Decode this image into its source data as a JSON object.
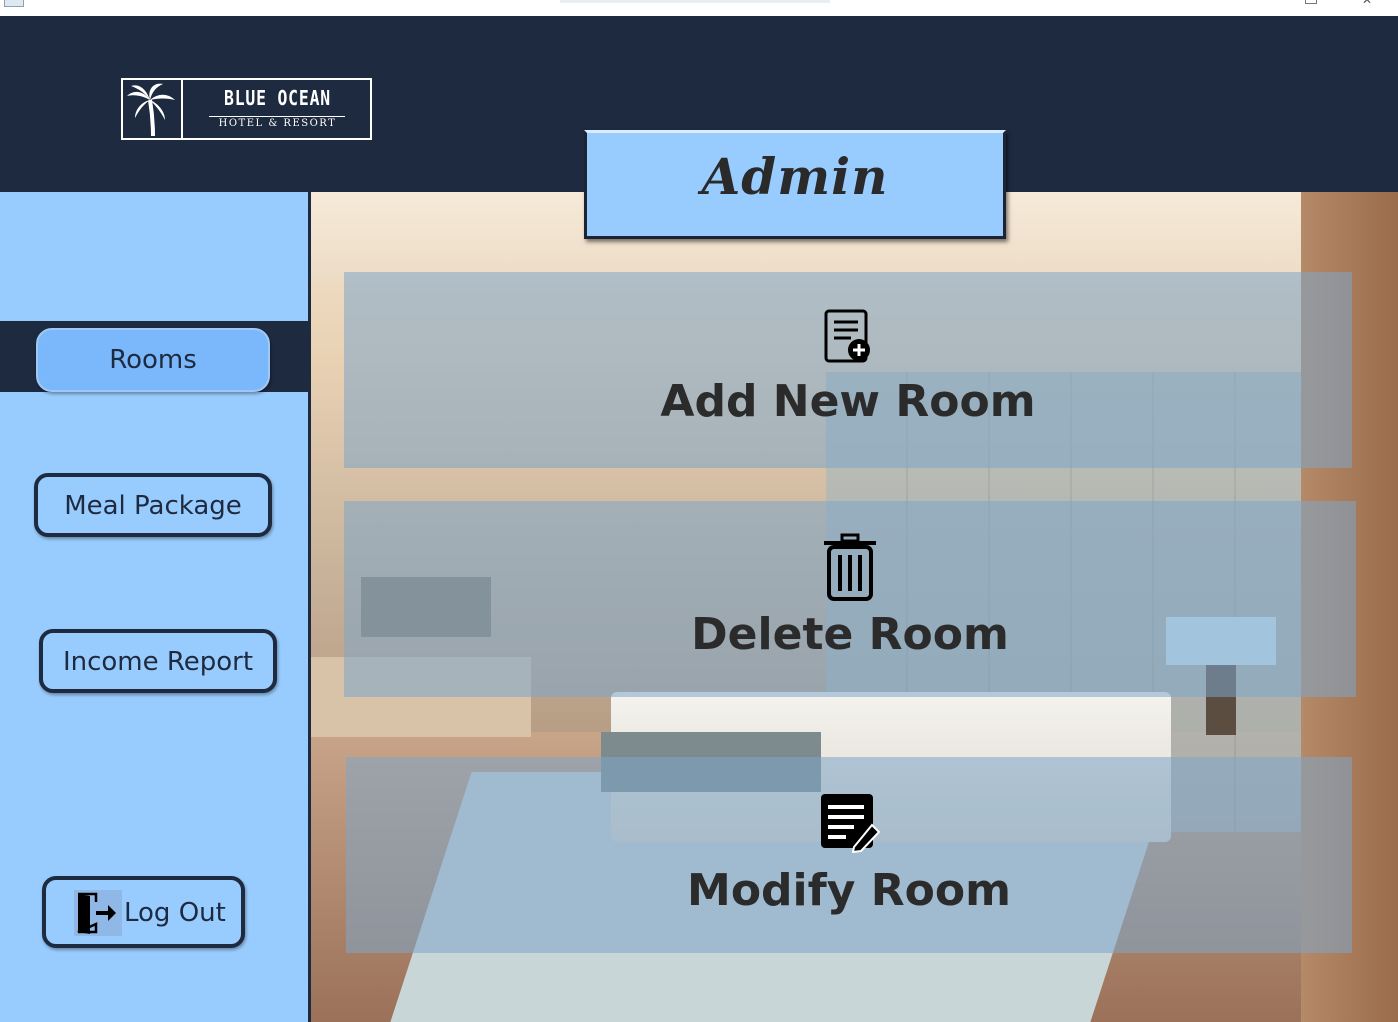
{
  "app": {
    "logo_title": "BLUE OCEAN",
    "logo_subtitle": "HOTEL & RESORT"
  },
  "header": {
    "title": "Admin"
  },
  "sidebar": {
    "items": [
      {
        "label": "Rooms",
        "active": true
      },
      {
        "label": "Meal Package",
        "active": false
      },
      {
        "label": "Income Report",
        "active": false
      }
    ],
    "logout_label": "Log Out"
  },
  "main": {
    "actions": [
      {
        "label": "Add New Room",
        "icon": "add-document-icon"
      },
      {
        "label": "Delete Room",
        "icon": "trash-icon"
      },
      {
        "label": "Modify Room",
        "icon": "edit-list-icon"
      }
    ]
  },
  "colors": {
    "navy": "#1e2a40",
    "light_blue": "#99ccfe",
    "active_blue": "#7ab8fb"
  }
}
